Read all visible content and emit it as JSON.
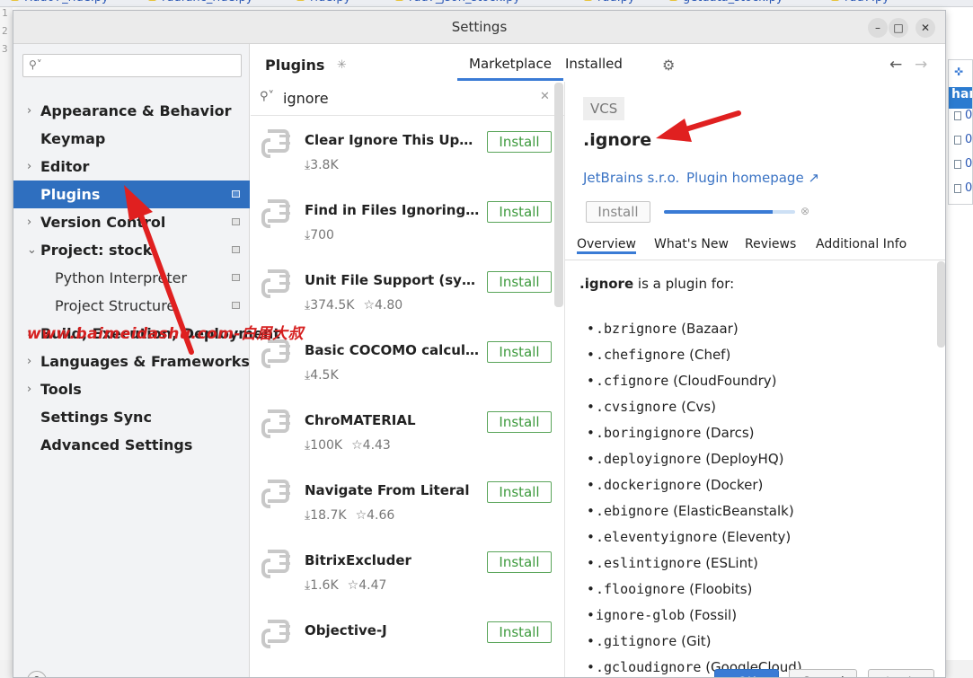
{
  "ide": {
    "tabs": [
      "Rdd07_ride.py",
      "rddfunc_ride.py",
      "ride.py",
      "rdd7_json_stock.py",
      "rdd.py",
      "getdata_stock.py",
      "rdd7.py"
    ],
    "gutter": [
      "1",
      "2",
      "3"
    ],
    "side_popup": {
      "title": "hang",
      "rows": [
        "0",
        "0",
        "0",
        "0"
      ]
    }
  },
  "dialog": {
    "title": "Settings",
    "window_buttons": [
      "–",
      "□",
      "✕"
    ]
  },
  "sidebar": {
    "search_placeholder": "",
    "items": [
      {
        "label": "Appearance & Behavior",
        "chevron": "›",
        "selected": false,
        "marker": false
      },
      {
        "label": "Keymap",
        "chevron": "",
        "selected": false,
        "marker": false
      },
      {
        "label": "Editor",
        "chevron": "›",
        "selected": false,
        "marker": false
      },
      {
        "label": "Plugins",
        "chevron": "",
        "selected": true,
        "marker": true
      },
      {
        "label": "Version Control",
        "chevron": "›",
        "selected": false,
        "marker": true
      },
      {
        "label": "Project: stock",
        "chevron": "⌄",
        "selected": false,
        "marker": true
      },
      {
        "label": "Python Interpreter",
        "chevron": "",
        "selected": false,
        "marker": true,
        "sub": true
      },
      {
        "label": "Project Structure",
        "chevron": "",
        "selected": false,
        "marker": true,
        "sub": true
      },
      {
        "label": "Build, Execution, Deployment",
        "chevron": "›",
        "selected": false,
        "marker": false
      },
      {
        "label": "Languages & Frameworks",
        "chevron": "›",
        "selected": false,
        "marker": false
      },
      {
        "label": "Tools",
        "chevron": "›",
        "selected": false,
        "marker": false
      },
      {
        "label": "Settings Sync",
        "chevron": "",
        "selected": false,
        "marker": false
      },
      {
        "label": "Advanced Settings",
        "chevron": "",
        "selected": false,
        "marker": false
      }
    ]
  },
  "plugins": {
    "title": "Plugins",
    "tabs": [
      "Marketplace",
      "Installed"
    ],
    "search_value": "ignore",
    "install_label": "Install",
    "list": [
      {
        "name": "Clear Ignore This Update",
        "downloads": "3.8K",
        "rating": ""
      },
      {
        "name": "Find in Files Ignoring W…",
        "downloads": "700",
        "rating": ""
      },
      {
        "name": "Unit File Support (syste…",
        "downloads": "374.5K",
        "rating": "4.80"
      },
      {
        "name": "Basic COCOMO calculator",
        "downloads": "4.5K",
        "rating": ""
      },
      {
        "name": "ChroMATERIAL",
        "downloads": "100K",
        "rating": "4.43"
      },
      {
        "name": "Navigate From Literal",
        "downloads": "18.7K",
        "rating": "4.66"
      },
      {
        "name": "BitrixExcluder",
        "downloads": "1.6K",
        "rating": "4.47"
      },
      {
        "name": "Objective-J",
        "downloads": "",
        "rating": ""
      }
    ]
  },
  "detail": {
    "tag": "VCS",
    "name": ".ignore",
    "vendor": "JetBrains s.r.o.",
    "homepage": "Plugin homepage ↗",
    "install_label": "Install",
    "progress": 0.83,
    "tabs": [
      "Overview",
      "What's New",
      "Reviews",
      "Additional Info"
    ],
    "intro_bold": ".ignore",
    "intro_rest": " is a plugin for:",
    "ignore_files": [
      {
        "file": ".bzrignore",
        "tool": "(Bazaar)"
      },
      {
        "file": ".chefignore",
        "tool": "(Chef)"
      },
      {
        "file": ".cfignore",
        "tool": "(CloudFoundry)"
      },
      {
        "file": ".cvsignore",
        "tool": "(Cvs)"
      },
      {
        "file": ".boringignore",
        "tool": "(Darcs)"
      },
      {
        "file": ".deployignore",
        "tool": "(DeployHQ)"
      },
      {
        "file": ".dockerignore",
        "tool": "(Docker)"
      },
      {
        "file": ".ebignore",
        "tool": "(ElasticBeanstalk)"
      },
      {
        "file": ".eleventyignore",
        "tool": "(Eleventy)"
      },
      {
        "file": ".eslintignore",
        "tool": "(ESLint)"
      },
      {
        "file": ".flooignore",
        "tool": "(Floobits)"
      },
      {
        "file": "ignore-glob",
        "tool": "(Fossil)"
      },
      {
        "file": ".gitignore",
        "tool": "(Git)"
      },
      {
        "file": ".gcloudignore",
        "tool": "(GoogleCloud)"
      }
    ]
  },
  "footer": {
    "help": "?",
    "ok": "OK",
    "cancel": "Cancel",
    "apply": "Apply"
  },
  "watermark": "www.baimeidashu.com-白眉大叔",
  "colors": {
    "accent": "#2f6fbf",
    "install_green": "#3d9a3d",
    "link": "#3a73c4",
    "annotation_red": "#e02020"
  }
}
